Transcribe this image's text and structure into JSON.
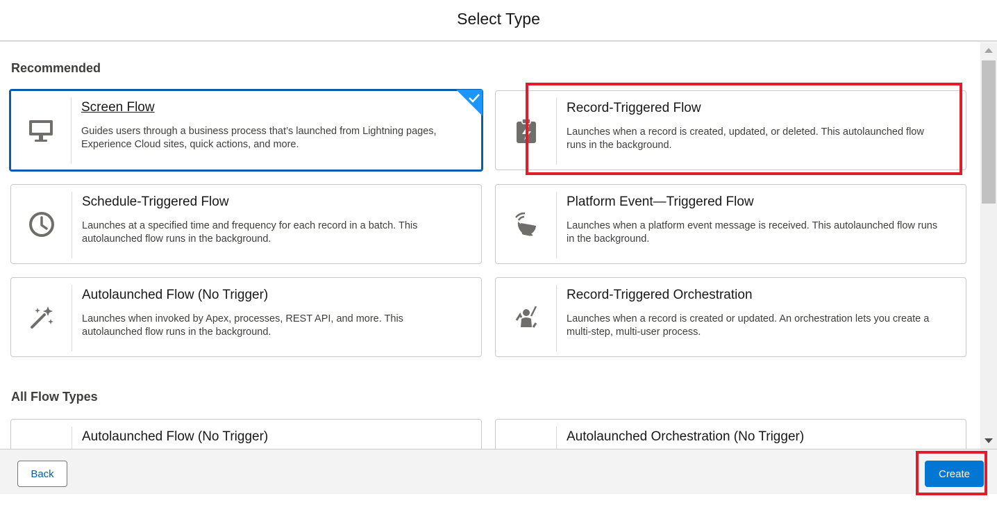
{
  "header": {
    "title": "Select Type"
  },
  "sections": {
    "recommended": "Recommended",
    "all": "All Flow Types"
  },
  "cards": [
    {
      "title": "Screen Flow",
      "desc": "Guides users through a business process that’s launched from Lightning pages, Experience Cloud sites, quick actions, and more.",
      "icon": "monitor-icon",
      "selected": true
    },
    {
      "title": "Record-Triggered Flow",
      "desc": "Launches when a record is created, updated, or deleted. This autolaunched flow runs in the background.",
      "icon": "clipboard-bolt-icon",
      "selected": false
    },
    {
      "title": "Schedule-Triggered Flow",
      "desc": "Launches at a specified time and frequency for each record in a batch. This autolaunched flow runs in the background.",
      "icon": "clock-icon",
      "selected": false
    },
    {
      "title": "Platform Event—Triggered Flow",
      "desc": "Launches when a platform event message is received. This autolaunched flow runs in the background.",
      "icon": "satellite-dish-icon",
      "selected": false
    },
    {
      "title": "Autolaunched Flow (No Trigger)",
      "desc": "Launches when invoked by Apex, processes, REST API, and more. This autolaunched flow runs in the background.",
      "icon": "magic-wand-icon",
      "selected": false
    },
    {
      "title": "Record-Triggered Orchestration",
      "desc": "Launches when a record is created or updated. An orchestration lets you create a multi-step, multi-user process.",
      "icon": "conductor-icon",
      "selected": false
    }
  ],
  "all_cards": [
    {
      "title": "Autolaunched Flow (No Trigger)",
      "icon": "magic-wand-icon"
    },
    {
      "title": "Autolaunched Orchestration (No Trigger)",
      "icon": "conductor-icon"
    }
  ],
  "footer": {
    "back_label": "Back",
    "create_label": "Create"
  },
  "colors": {
    "brand": "#0176d3",
    "selected_border": "#0b5cab",
    "annotation": "#e01e2b"
  }
}
